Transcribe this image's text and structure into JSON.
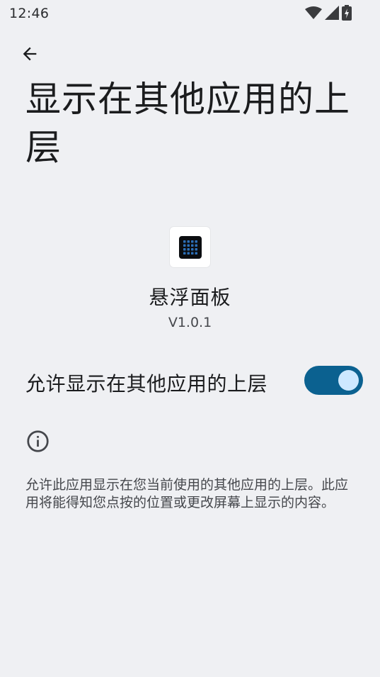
{
  "status_bar": {
    "time": "12:46",
    "icons": [
      "wifi-icon",
      "cellular-signal-icon",
      "battery-charging-icon"
    ]
  },
  "nav": {
    "back_icon": "arrow-back-icon"
  },
  "page": {
    "title": "显示在其他应用的上层"
  },
  "app": {
    "name": "悬浮面板",
    "version": "V1.0.1",
    "icon": "app-grid-icon"
  },
  "permission": {
    "label": "允许显示在其他应用的上层",
    "enabled": true
  },
  "info": {
    "icon": "info-icon",
    "description": "允许此应用显示在您当前使用的其他应用的上层。此应用将能得知您点按的位置或更改屏幕上显示的内容。"
  },
  "colors": {
    "background": "#eff0f3",
    "toggle_track": "#0b6190",
    "toggle_thumb": "#cde8ff",
    "app_icon_dots": "#2c6fb8"
  }
}
